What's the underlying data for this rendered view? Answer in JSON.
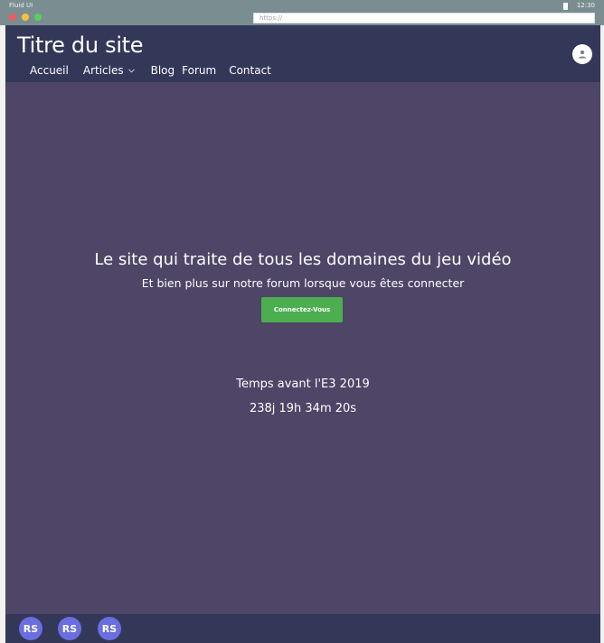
{
  "os": {
    "app_name": "Fluid UI",
    "time": "12:30",
    "url_placeholder": "https://",
    "battery_icon": "battery-icon"
  },
  "header": {
    "site_title": "Titre du site",
    "nav": [
      {
        "label": "Accueil"
      },
      {
        "label": "Articles",
        "has_dropdown": true
      },
      {
        "label": "Blog"
      },
      {
        "label": "Forum"
      },
      {
        "label": "Contact"
      }
    ],
    "dropdown_icon": "chevron-down-icon",
    "user_icon": "user-icon"
  },
  "hero": {
    "title": "Le site qui traite de tous les domaines du jeu vidéo",
    "subtitle": "Et bien plus sur notre forum lorsque vous êtes connecter",
    "button_label": "Connectez-Vous"
  },
  "countdown": {
    "label": "Temps avant l'E3 2019",
    "value": "238j 19h 34m 20s"
  },
  "footer": {
    "avatars": [
      {
        "initials": "RS"
      },
      {
        "initials": "RS"
      },
      {
        "initials": "RS"
      }
    ]
  },
  "colors": {
    "accent_green": "#4cae4f",
    "header_bg": "#333859",
    "page_bg": "#4e4567",
    "avatar_bg": "#6b6ee0"
  }
}
